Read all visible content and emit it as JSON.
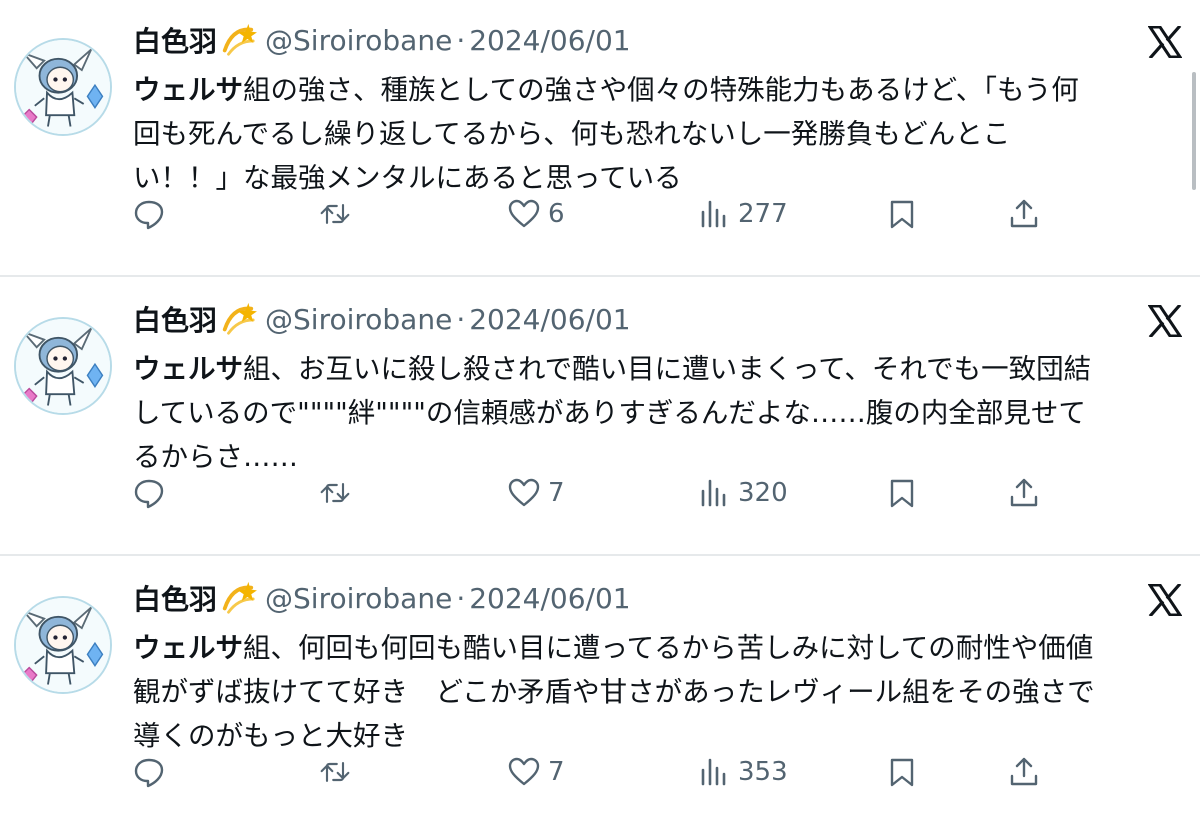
{
  "tweets": [
    {
      "author": {
        "display_name": "白色羽",
        "badge_emoji": "💫",
        "handle": "@Siroirobane",
        "separator": "·",
        "date": "2024/06/01"
      },
      "text_lead": "ウェルサ",
      "text_lines": [
        "組の強さ、種族としての強さや個々の特殊能力もあるけど、「もう何",
        "回も死んでるし繰り返してるから、何も恐れないし一発勝負もどんとこ",
        "い！！」な最強メンタルにあると思っている"
      ],
      "likes": "6",
      "views": "277"
    },
    {
      "author": {
        "display_name": "白色羽",
        "badge_emoji": "💫",
        "handle": "@Siroirobane",
        "separator": "·",
        "date": "2024/06/01"
      },
      "text_lead": "ウェルサ",
      "text_lines": [
        "組、お互いに殺し殺されで酷い目に遭いまくって、それでも一致団結",
        "しているので\"\"\"\"絆\"\"\"\"の信頼感がありすぎるんだよな……腹の内全部見せて",
        "るからさ……"
      ],
      "likes": "7",
      "views": "320"
    },
    {
      "author": {
        "display_name": "白色羽",
        "badge_emoji": "💫",
        "handle": "@Siroirobane",
        "separator": "·",
        "date": "2024/06/01"
      },
      "text_lead": "ウェルサ",
      "text_lines": [
        "組、何回も何回も酷い目に遭ってるから苦しみに対しての耐性や価値",
        "観がずば抜けてて好き　どこか矛盾や甘さがあったレヴィール組をその強さで",
        "導くのがもっと大好き"
      ],
      "likes": "7",
      "views": "353"
    }
  ],
  "icons": {
    "reply": "reply-icon",
    "retweet": "retweet-icon",
    "like": "heart-icon",
    "views": "views-icon",
    "bookmark": "bookmark-icon",
    "share": "share-icon",
    "source": "x-logo-icon"
  },
  "colors": {
    "text": "#0f1419",
    "muted": "#536471",
    "divider": "#e6e9eb",
    "avatar_ring": "#b7dbe8"
  }
}
